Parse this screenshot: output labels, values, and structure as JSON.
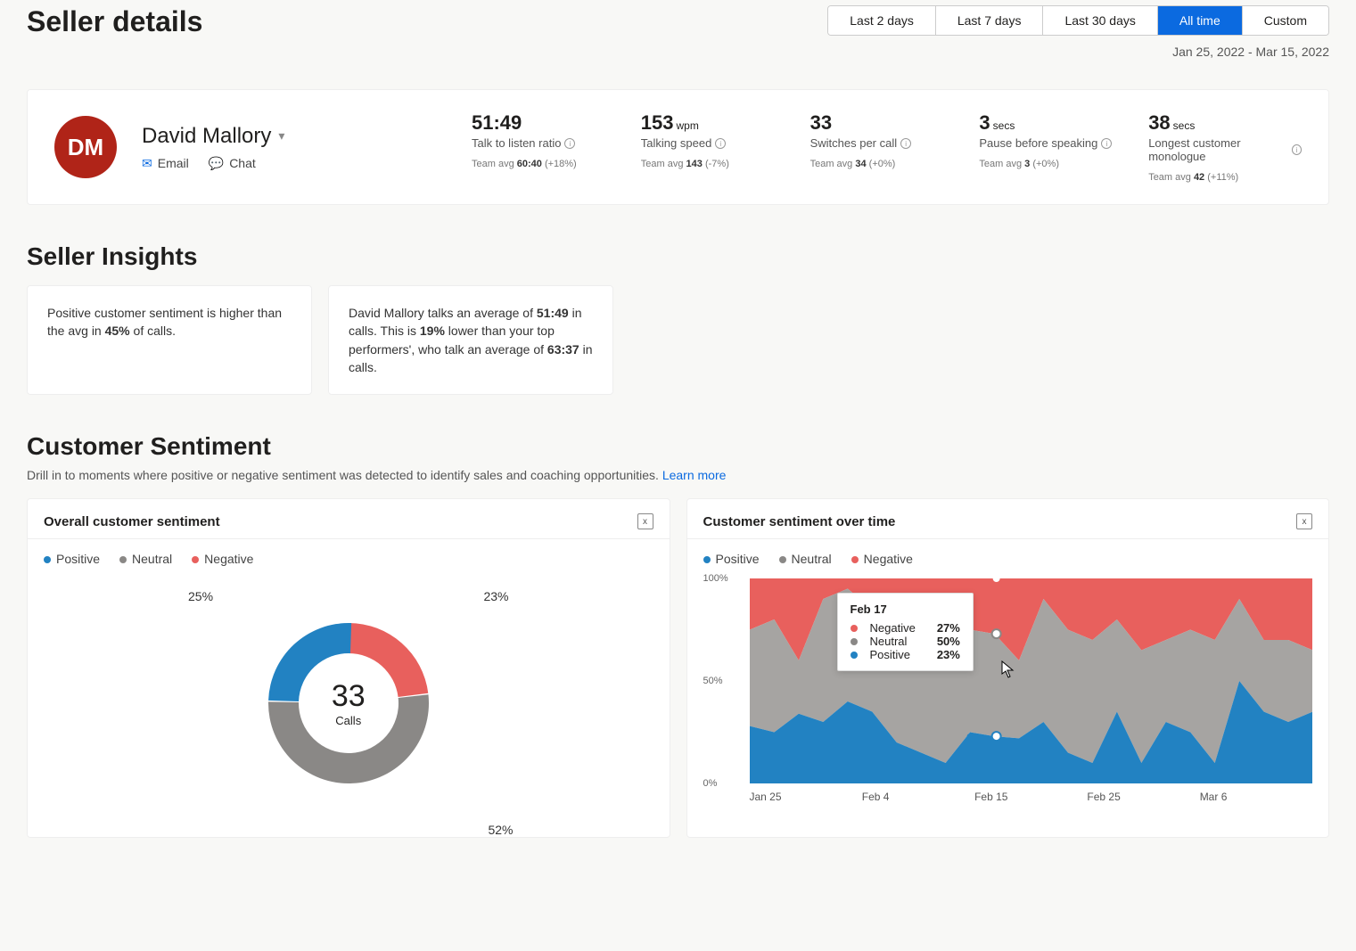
{
  "page": {
    "title": "Seller details",
    "date_range": "Jan 25, 2022 - Mar 15, 2022"
  },
  "time_filter": {
    "options": [
      "Last 2 days",
      "Last 7 days",
      "Last 30 days",
      "All time",
      "Custom"
    ],
    "active_index": 3
  },
  "seller": {
    "initials": "DM",
    "name": "David Mallory",
    "email_label": "Email",
    "chat_label": "Chat"
  },
  "metrics": [
    {
      "value": "51:49",
      "unit": "",
      "label": "Talk to listen ratio",
      "team_avg": "60:40",
      "delta": "(+18%)"
    },
    {
      "value": "153",
      "unit": "wpm",
      "label": "Talking speed",
      "team_avg": "143",
      "delta": "(-7%)"
    },
    {
      "value": "33",
      "unit": "",
      "label": "Switches per call",
      "team_avg": "34",
      "delta": "(+0%)"
    },
    {
      "value": "3",
      "unit": "secs",
      "label": "Pause before speaking",
      "team_avg": "3",
      "delta": "(+0%)"
    },
    {
      "value": "38",
      "unit": "secs",
      "label": "Longest customer monologue",
      "team_avg": "42",
      "delta": "(+11%)"
    }
  ],
  "insights": {
    "heading": "Seller Insights",
    "cards": [
      {
        "html": "Positive customer sentiment is higher than the avg in <b>45%</b> of calls."
      },
      {
        "html": "David Mallory talks an average of <b>51:49</b> in calls. This is <b>19%</b> lower than your top performers', who talk an average of <b>63:37</b> in calls."
      }
    ]
  },
  "sentiment_section": {
    "heading": "Customer Sentiment",
    "subtext": "Drill in to moments where positive or negative sentiment was detected to identify sales and coaching opportunities. ",
    "learn_more": "Learn more"
  },
  "donut_panel": {
    "title": "Overall customer sentiment",
    "legend": {
      "positive": "Positive",
      "neutral": "Neutral",
      "negative": "Negative"
    },
    "center_value": "33",
    "center_label": "Calls",
    "labels": {
      "positive": "25%",
      "neutral": "52%",
      "negative": "23%"
    }
  },
  "area_panel": {
    "title": "Customer sentiment over time",
    "legend": {
      "positive": "Positive",
      "neutral": "Neutral",
      "negative": "Negative"
    },
    "y_ticks": [
      "100%",
      "50%",
      "0%"
    ],
    "x_ticks": [
      "Jan 25",
      "Feb 4",
      "Feb 15",
      "Feb 25",
      "Mar 6"
    ],
    "tooltip": {
      "title": "Feb 17",
      "rows": [
        {
          "class": "neg",
          "label": "Negative",
          "value": "27%"
        },
        {
          "class": "neu",
          "label": "Neutral",
          "value": "50%"
        },
        {
          "class": "pos",
          "label": "Positive",
          "value": "23%"
        }
      ]
    }
  },
  "chart_data": [
    {
      "type": "pie",
      "title": "Overall customer sentiment",
      "series": [
        {
          "name": "Positive",
          "value": 25
        },
        {
          "name": "Neutral",
          "value": 52
        },
        {
          "name": "Negative",
          "value": 23
        }
      ],
      "center_total": 33,
      "center_label": "Calls"
    },
    {
      "type": "area",
      "title": "Customer sentiment over time",
      "ylabel": "%",
      "ylim": [
        0,
        100
      ],
      "x_ticks": [
        "Jan 25",
        "Feb 4",
        "Feb 15",
        "Feb 25",
        "Mar 6"
      ],
      "series": [
        {
          "name": "Positive",
          "values": [
            28,
            25,
            34,
            30,
            40,
            35,
            20,
            15,
            10,
            25,
            23,
            22,
            30,
            15,
            10,
            35,
            10,
            30,
            25,
            10,
            50,
            35,
            30,
            35
          ]
        },
        {
          "name": "Neutral",
          "values": [
            47,
            55,
            26,
            60,
            55,
            50,
            45,
            50,
            60,
            50,
            50,
            38,
            60,
            60,
            60,
            45,
            55,
            40,
            50,
            60,
            40,
            35,
            40,
            30
          ]
        },
        {
          "name": "Negative",
          "values": [
            25,
            20,
            40,
            10,
            5,
            15,
            35,
            35,
            30,
            25,
            27,
            40,
            10,
            25,
            30,
            20,
            35,
            30,
            25,
            30,
            10,
            30,
            30,
            35
          ]
        }
      ]
    }
  ]
}
